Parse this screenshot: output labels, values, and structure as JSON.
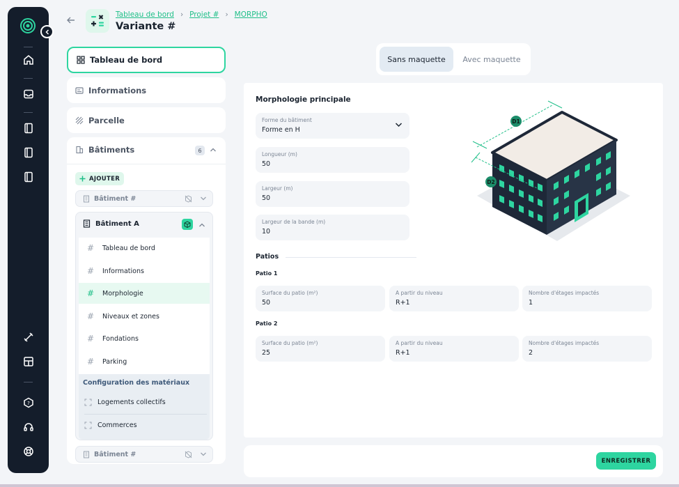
{
  "breadcrumb": [
    "Tableau de bord",
    "Projet #",
    "MORPHO"
  ],
  "page_title": "Variante #",
  "nav": {
    "dashboard": "Tableau de bord",
    "informations": "Informations",
    "parcelle": "Parcelle",
    "batiments": "Bâtiments",
    "batiments_count": "6",
    "add_label": "AJOUTER"
  },
  "buildings": {
    "first_row": "Bâtiment #",
    "open": "Bâtiment A",
    "last_row": "Bâtiment #",
    "sub_items": [
      "Tableau de bord",
      "Informations",
      "Morphologie",
      "Niveaux et zones",
      "Fondations",
      "Parking"
    ],
    "config_title": "Configuration des matériaux",
    "config_items": [
      "Logements collectifs",
      "Commerces"
    ]
  },
  "tabs": {
    "active": "Sans maquette",
    "inactive": "Avec maquette"
  },
  "form": {
    "section_title": "Morphologie principale",
    "forme_label": "Forme du bâtiment",
    "forme_value": "Forme en H",
    "longueur_label": "Longueur (m)",
    "longueur_value": "50",
    "largeur_label": "Largeur (m)",
    "largeur_value": "50",
    "bande_label": "Largeur de la bande (m)",
    "bande_value": "10",
    "patios_title": "Patios",
    "patios": [
      {
        "title": "Patio 1",
        "surface_label": "Surface du patio (m²)",
        "surface": "50",
        "niveau_label": "A partir du niveau",
        "niveau": "R+1",
        "etages_label": "Nombre d'étages impactés",
        "etages": "1"
      },
      {
        "title": "Patio 2",
        "surface_label": "Surface du patio (m²)",
        "surface": "25",
        "niveau_label": "A partir du niveau",
        "niveau": "R+1",
        "etages_label": "Nombre d'étages impactés",
        "etages": "2"
      }
    ]
  },
  "diagram": {
    "d1": "D1",
    "d2": "D2"
  },
  "footer": {
    "save": "ENREGISTRER"
  },
  "colors": {
    "accent": "#2ed5a0",
    "dark": "#141d2b",
    "link": "#1fbf88"
  }
}
